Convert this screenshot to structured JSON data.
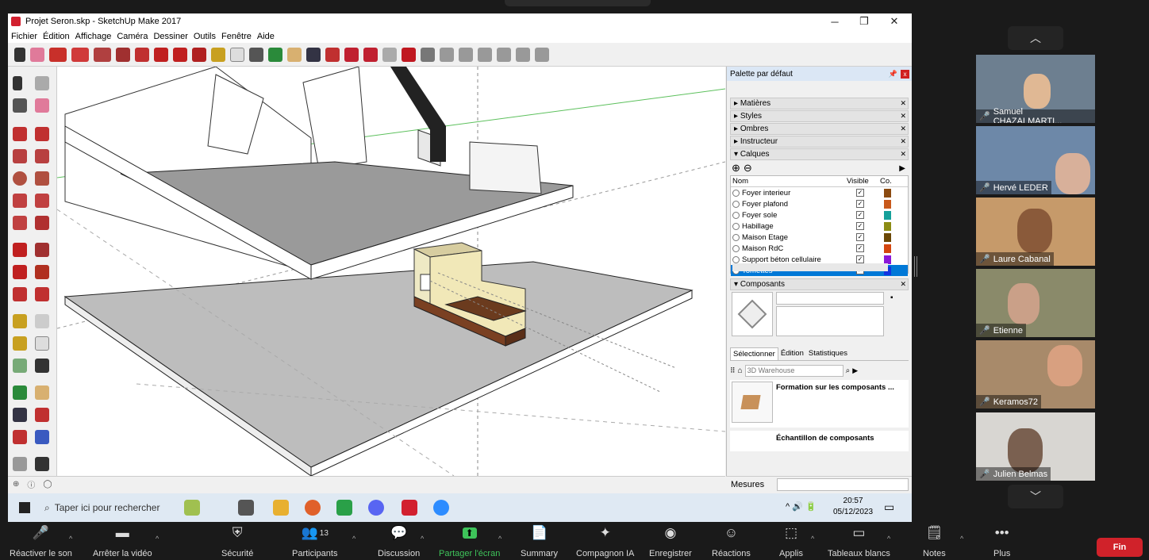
{
  "window": {
    "title": "Projet Seron.skp - SketchUp Make 2017",
    "min": "─",
    "max": "❐",
    "close": "✕"
  },
  "menu": [
    "Fichier",
    "Édition",
    "Affichage",
    "Caméra",
    "Dessiner",
    "Outils",
    "Fenêtre",
    "Aide"
  ],
  "panel": {
    "title": "Palette par défaut",
    "trays": [
      "Matières",
      "Styles",
      "Ombres",
      "Instructeur",
      "Calques"
    ],
    "layer_headers": {
      "name": "Nom",
      "visible": "Visible",
      "color": "Co."
    },
    "layers": [
      {
        "name": "Foyer interieur",
        "color": "#8b4a10"
      },
      {
        "name": "Foyer plafond",
        "color": "#c8591b"
      },
      {
        "name": "Foyer sole",
        "color": "#15a09a"
      },
      {
        "name": "Habillage",
        "color": "#8c8c14"
      },
      {
        "name": "Maison Etage",
        "color": "#6b4806"
      },
      {
        "name": "Maison RdC",
        "color": "#d4460f"
      },
      {
        "name": "Support béton cellulaire",
        "color": "#8a18d8"
      },
      {
        "name": "Tomettes",
        "color": "#1234e0"
      }
    ],
    "components_tray": "Composants",
    "tabs": [
      "Sélectionner",
      "Édition",
      "Statistiques"
    ],
    "search_placeholder": "3D Warehouse",
    "items": [
      "Formation sur les composants ...",
      "Échantillon de composants"
    ],
    "mesures": "Mesures"
  },
  "taskbar": {
    "search": "Taper ici pour rechercher",
    "time": "20:57",
    "date": "05/12/2023",
    "tray": "^ 🔊 🔋"
  },
  "participants": [
    {
      "name": "Samuel CHAZALMARTI..."
    },
    {
      "name": "Hervé LEDER"
    },
    {
      "name": "Laure Cabanal"
    },
    {
      "name": "Etienne"
    },
    {
      "name": "Keramos72"
    },
    {
      "name": "Julien Belmas"
    }
  ],
  "zoom": {
    "items": [
      {
        "label": "Réactiver le son",
        "icon": "🎤"
      },
      {
        "label": "Arrêter la vidéo",
        "icon": "▬"
      },
      {
        "label": "Sécurité",
        "icon": "⛨"
      },
      {
        "label": "Participants",
        "icon": "👥",
        "badge": "13"
      },
      {
        "label": "Discussion",
        "icon": "💬"
      },
      {
        "label": "Partager l'écran",
        "icon": "⬆"
      },
      {
        "label": "Summary",
        "icon": "📄"
      },
      {
        "label": "Compagnon IA",
        "icon": "✦"
      },
      {
        "label": "Enregistrer",
        "icon": "◉"
      },
      {
        "label": "Réactions",
        "icon": "☺"
      },
      {
        "label": "Applis",
        "icon": "⬚"
      },
      {
        "label": "Tableaux blancs",
        "icon": "▭"
      },
      {
        "label": "Notes",
        "icon": "🗒"
      },
      {
        "label": "Plus",
        "icon": "•••"
      }
    ],
    "end": "Fin"
  }
}
